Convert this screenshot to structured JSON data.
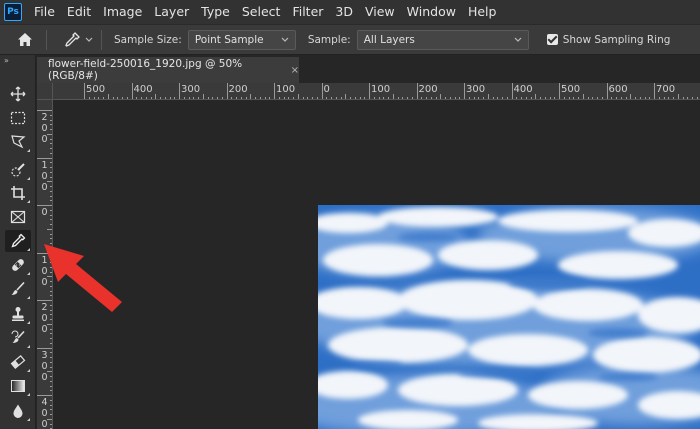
{
  "app": {
    "logo_text": "Ps"
  },
  "menu": [
    "File",
    "Edit",
    "Image",
    "Layer",
    "Type",
    "Select",
    "Filter",
    "3D",
    "View",
    "Window",
    "Help"
  ],
  "options": {
    "sample_size_label": "Sample Size:",
    "sample_size_value": "Point Sample",
    "sample_label": "Sample:",
    "sample_value": "All Layers",
    "show_sampling_ring_label": "Show Sampling Ring",
    "show_sampling_ring_checked": true
  },
  "toolbar": {
    "collapse_glyph": "»",
    "tools": [
      "move-tool",
      "rectangular-marquee-tool",
      "lasso-tool",
      "quick-selection-tool",
      "crop-tool",
      "frame-tool",
      "eyedropper-tool",
      "spot-healing-brush-tool",
      "brush-tool",
      "clone-stamp-tool",
      "history-brush-tool",
      "eraser-tool",
      "gradient-tool",
      "blur-tool"
    ],
    "active_tool": "eyedropper-tool"
  },
  "document": {
    "tab_title": "flower-field-250016_1920.jpg @ 50% (RGB/8#)",
    "close_glyph": "×"
  },
  "ruler_top_labels": [
    "500",
    "400",
    "300",
    "200",
    "100",
    "0",
    "100",
    "200",
    "300",
    "400",
    "500",
    "600",
    "700"
  ],
  "ruler_left_labels": [
    "200",
    "100",
    "0",
    "100",
    "200",
    "300",
    "400"
  ],
  "colors": {
    "menubar": "#323232",
    "options": "#3a3a3a",
    "canvas": "#262626",
    "annotation_arrow": "#e8322b",
    "sky": "#2f72c8"
  }
}
